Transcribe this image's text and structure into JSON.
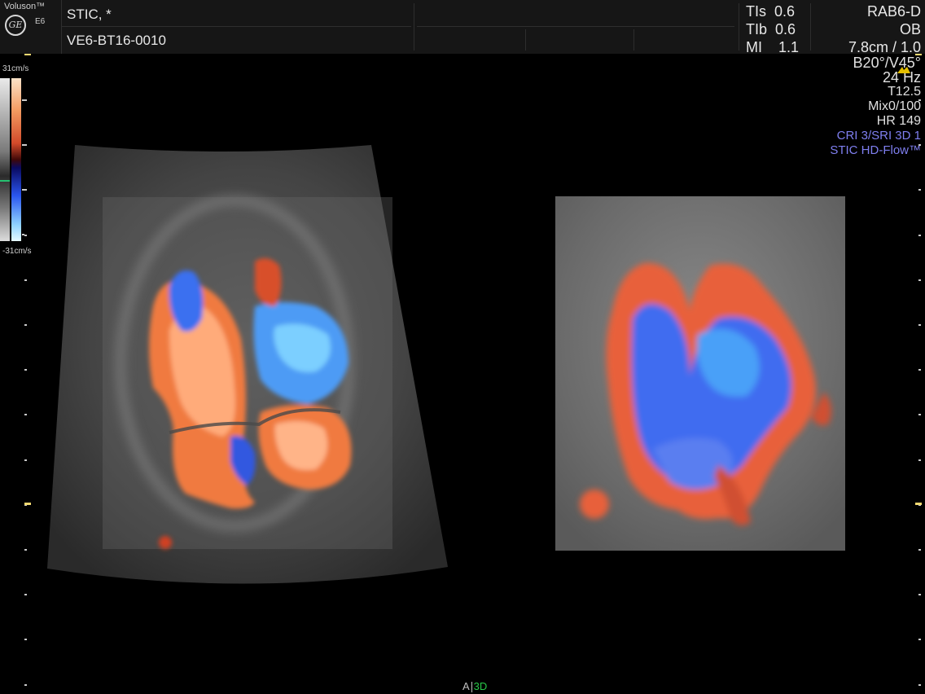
{
  "brand": {
    "name": "Voluson™",
    "model": "E6",
    "logo": "GE"
  },
  "header": {
    "study_label": "STIC,   *",
    "patient_id": "VE6-BT16-0010"
  },
  "safety": [
    {
      "label": "TIs",
      "value": "0.6"
    },
    {
      "label": "TIb",
      "value": "0.6"
    },
    {
      "label": "MI",
      "value": "1.1"
    }
  ],
  "probe": {
    "name": "RAB6-D",
    "preset": "OB",
    "depth": "7.8cm / 1.0"
  },
  "params": {
    "angles": "B20°/V45°",
    "frame_rate": "24 Hz",
    "t_value": "T12.5",
    "mix": "Mix0/100",
    "heart_rate": "HR 149",
    "cri": "CRI 3/SRI 3D 1",
    "flow_mode": "STIC HD-Flow™"
  },
  "color_scale": {
    "max_label": "31cm/s",
    "min_label": "-31cm/s",
    "baseline_color": "#26c070"
  },
  "bottom": {
    "plane": "A",
    "mode": "3D"
  },
  "colors": {
    "background": "#000000",
    "header": "#161616",
    "accent_blue": "#7f7ff0",
    "accent_green": "#28c848"
  }
}
